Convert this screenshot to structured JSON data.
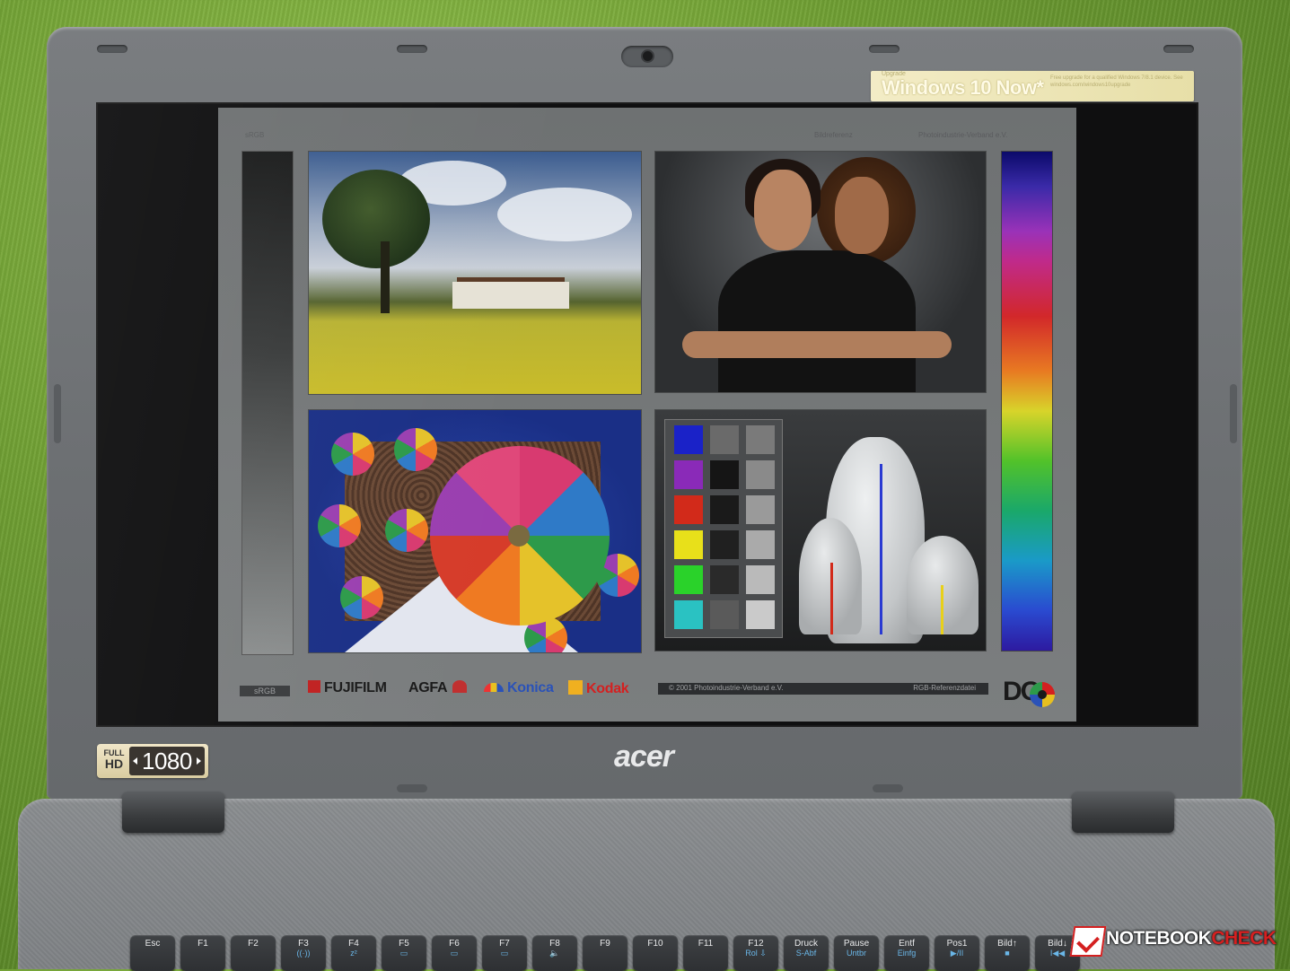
{
  "sticker": {
    "small": "Upgrade",
    "title": "Windows 10 Now*",
    "fine": "Free upgrade for a qualified Windows 7/8.1 device. See windows.com/windows10upgrade"
  },
  "screen_image": {
    "top_left_text": "sRGB",
    "top_mid_text": "Bildreferenz",
    "top_right_text": "Photoindustrie-Verband e.V.",
    "srgb_label": "sRGB",
    "brands": [
      "FUJIFILM",
      "AGFA",
      "Konica",
      "Kodak"
    ],
    "copyright": "© 2001  Photoindustrie-Verband e.V.",
    "ref_label": "RGB-Referenzdatei",
    "logo": "DO"
  },
  "colors": {
    "swatches": [
      "#1a22c8",
      "#8a2ab8",
      "#d22a1a",
      "#e8e01a",
      "#2ad22a",
      "#2ac2c2"
    ],
    "grays_dark": [
      "#6a6a6a",
      "#151515",
      "#1a1a1a",
      "#202020",
      "#2a2a2a",
      "#5a5a5a"
    ],
    "grays_light": [
      "#7a7a7a",
      "#8a8a8a",
      "#9a9a9a",
      "#aaaaaa",
      "#bababa",
      "#cacaca"
    ]
  },
  "bezel": {
    "hd_full": "FULL",
    "hd_hd": "HD",
    "hd_res": "1080",
    "brand": "acer"
  },
  "keyboard": {
    "keys": [
      {
        "k1": "Esc",
        "k2": ""
      },
      {
        "k1": "F1",
        "k2": ""
      },
      {
        "k1": "F2",
        "k2": ""
      },
      {
        "k1": "F3",
        "k2": "((·))"
      },
      {
        "k1": "F4",
        "k2": "z²"
      },
      {
        "k1": "F5",
        "k2": "▭"
      },
      {
        "k1": "F6",
        "k2": "▭"
      },
      {
        "k1": "F7",
        "k2": "▭"
      },
      {
        "k1": "F8",
        "k2": "🔈"
      },
      {
        "k1": "F9",
        "k2": ""
      },
      {
        "k1": "F10",
        "k2": ""
      },
      {
        "k1": "F11",
        "k2": ""
      },
      {
        "k1": "F12",
        "k2": "Rol ⇩"
      },
      {
        "k1": "Druck",
        "k2": "S-Abf"
      },
      {
        "k1": "Pause",
        "k2": "Untbr"
      },
      {
        "k1": "Entf",
        "k2": "Einfg"
      },
      {
        "k1": "Pos1",
        "k2": "▶/II"
      },
      {
        "k1": "Bild↑",
        "k2": "■"
      },
      {
        "k1": "Bild↓",
        "k2": "I◀◀"
      }
    ]
  },
  "watermark": {
    "part1": "NOTEBOOK",
    "part2": "CHECK"
  }
}
